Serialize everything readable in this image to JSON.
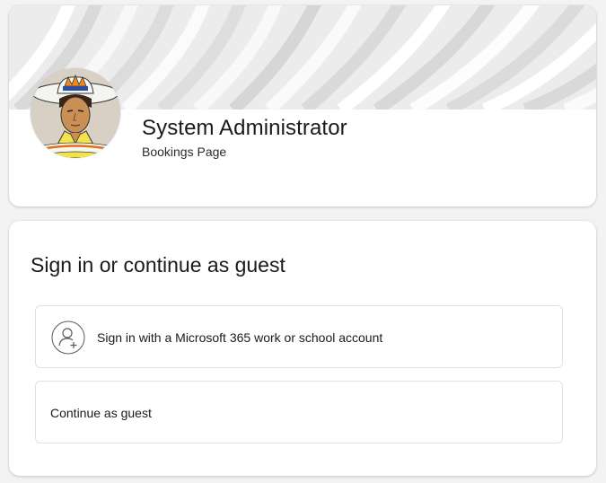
{
  "header": {
    "title": "System Administrator",
    "subtitle": "Bookings Page"
  },
  "signin": {
    "heading": "Sign in or continue as guest",
    "options": [
      {
        "label": "Sign in with a Microsoft 365 work or school account",
        "icon": "person-add-icon"
      },
      {
        "label": "Continue as guest"
      }
    ]
  },
  "colors": {
    "page_background": "#f3f3f3",
    "card_background": "#ffffff",
    "option_border": "#e1e1e1",
    "text": "#1a1a1a"
  }
}
